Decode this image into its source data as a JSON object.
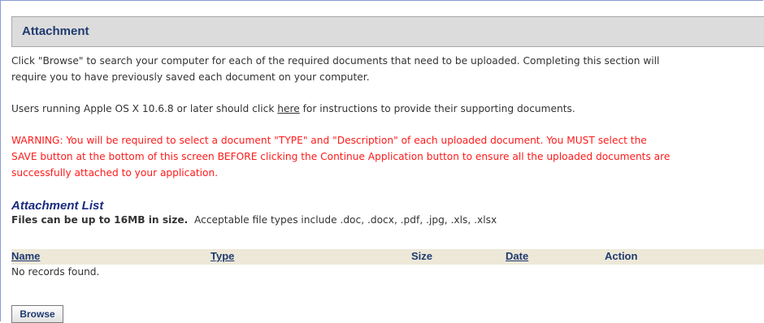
{
  "section": {
    "title": "Attachment"
  },
  "intro": {
    "line1": "Click \"Browse\" to search your computer for each of the required documents that need to be uploaded.  Completing this section will",
    "line2": "require you to have previously saved each document on your computer."
  },
  "apple_note": {
    "before": "Users running Apple OS X 10.6.8 or later should click ",
    "link": "here",
    "after": " for instructions to provide their supporting documents."
  },
  "warning": {
    "line1": "WARNING: You will be required to select a document \"TYPE\" and \"Description\" of each uploaded document. You MUST select the",
    "line2": "SAVE button at the bottom of this screen BEFORE clicking the Continue Application button to ensure all the uploaded documents are",
    "line3": "successfully attached to your application."
  },
  "attachment_list": {
    "title": "Attachment List",
    "size_note": "Files can be up to 16MB in size.",
    "types_note": "  Acceptable file types include .doc, .docx, .pdf, .jpg, .xls, .xlsx",
    "columns": {
      "name": "Name",
      "type": "Type",
      "size": "Size",
      "date": "Date",
      "action": "Action"
    },
    "empty_message": "No records found."
  },
  "buttons": {
    "browse": "Browse"
  },
  "colors": {
    "header_bg": "#dcdcdc",
    "header_text": "#1f3a70",
    "warning_text": "#ff1a1a",
    "table_header_bg": "#ede8d8"
  }
}
